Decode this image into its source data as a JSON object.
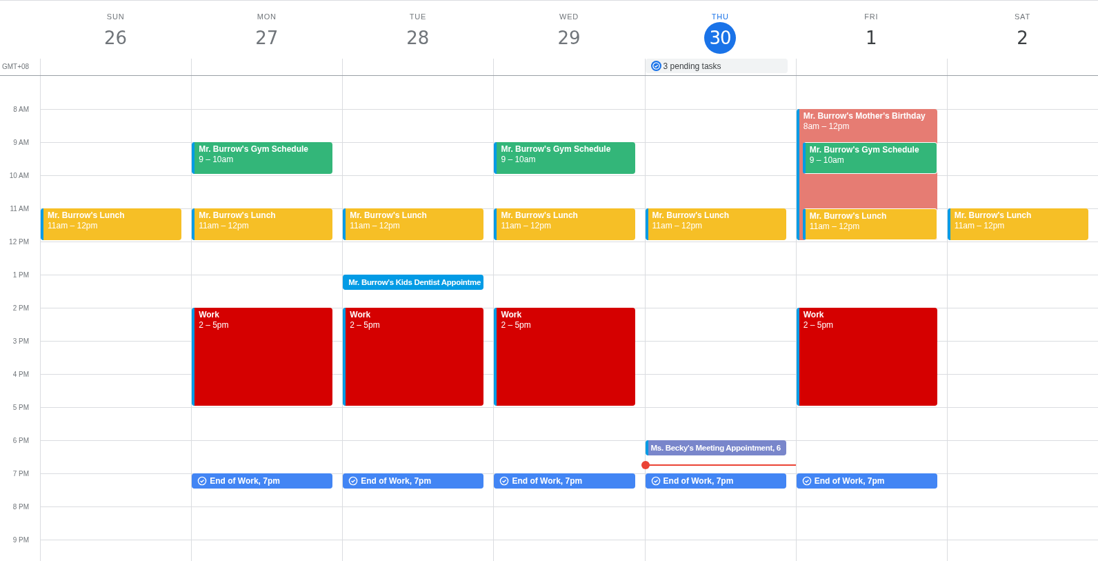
{
  "timezone": "GMT+08",
  "hours": [
    "8 AM",
    "9 AM",
    "10 AM",
    "11 AM",
    "12 PM",
    "1 PM",
    "2 PM",
    "3 PM",
    "4 PM",
    "5 PM",
    "6 PM",
    "7 PM",
    "8 PM",
    "9 PM"
  ],
  "days": [
    {
      "name": "SUN",
      "number": "26",
      "selected": false,
      "past": true,
      "slots": [
        [
          {
            "kind": "free"
          }
        ],
        [
          {
            "kind": "free"
          }
        ],
        [
          {
            "kind": "free"
          }
        ],
        [
          {
            "kind": "free"
          }
        ],
        [
          {
            "kind": "event",
            "title": "Mr. Burrow's Lunch",
            "time": "11am – 12pm",
            "color": "#f6bf26",
            "nested": false
          }
        ]
      ]
    },
    {
      "name": "MON",
      "number": "27",
      "selected": false,
      "past": true,
      "slots": [
        [
          {
            "kind": "free"
          }
        ],
        [
          {
            "kind": "free"
          }
        ],
        [
          {
            "kind": "event",
            "title": "Mr. Burrow's Gym Schedule",
            "time": "9 – 10am",
            "color": "#33b679",
            "nested": false
          }
        ],
        [
          {
            "kind": "free"
          }
        ],
        [
          {
            "kind": "event",
            "title": "Mr. Burrow's Lunch",
            "time": "11am – 12pm",
            "color": "#f6bf26",
            "nested": false
          }
        ],
        [
          {
            "kind": "free"
          }
        ],
        [
          {
            "kind": "free"
          }
        ],
        [
          {
            "kind": "event",
            "title": "Work",
            "time": "2 – 5pm",
            "color": "#d50000",
            "nested": false
          }
        ],
        [
          {
            "kind": "free"
          }
        ],
        [
          {
            "kind": "free"
          }
        ],
        [
          {
            "kind": "free"
          }
        ],
        [
          {
            "kind": "free"
          }
        ],
        [
          {
            "kind": "task",
            "title": "End of Work, 7pm",
            "color": "#4285f4",
            "nested": false
          }
        ]
      ]
    },
    {
      "name": "TUE",
      "number": "28",
      "selected": false,
      "past": true,
      "slots": [
        [
          {
            "kind": "free"
          }
        ],
        [
          {
            "kind": "free"
          }
        ],
        [
          {
            "kind": "free"
          }
        ],
        [
          {
            "kind": "free"
          }
        ],
        [
          {
            "kind": "event",
            "title": "Mr. Burrow's Lunch",
            "time": "11am – 12pm",
            "color": "#f6bf26",
            "nested": false
          }
        ],
        [
          {
            "kind": "free"
          }
        ],
        [
          {
            "kind": "compact",
            "title": "Mr. Burrow's Kids Dentist Appointme",
            "color": "#039be5",
            "nested": false
          }
        ],
        [
          {
            "kind": "event",
            "title": "Work",
            "time": "2 – 5pm",
            "color": "#d50000",
            "nested": false
          }
        ],
        [
          {
            "kind": "free"
          }
        ],
        [
          {
            "kind": "free"
          }
        ],
        [
          {
            "kind": "free"
          }
        ],
        [
          {
            "kind": "free"
          }
        ],
        [
          {
            "kind": "task",
            "title": "End of Work, 7pm",
            "color": "#4285f4",
            "nested": false
          }
        ]
      ]
    },
    {
      "name": "WED",
      "number": "29",
      "selected": false,
      "past": true,
      "slots": [
        [
          {
            "kind": "free"
          }
        ],
        [
          {
            "kind": "free"
          }
        ],
        [
          {
            "kind": "event",
            "title": "Mr. Burrow's Gym Schedule",
            "time": "9 – 10am",
            "color": "#33b679",
            "nested": false
          }
        ],
        [
          {
            "kind": "free"
          }
        ],
        [
          {
            "kind": "event",
            "title": "Mr. Burrow's Lunch",
            "time": "11am – 12pm",
            "color": "#f6bf26",
            "nested": false
          }
        ],
        [
          {
            "kind": "free"
          }
        ],
        [
          {
            "kind": "free"
          }
        ],
        [
          {
            "kind": "event",
            "title": "Work",
            "time": "2 – 5pm",
            "color": "#d50000",
            "nested": false
          }
        ],
        [
          {
            "kind": "free"
          }
        ],
        [
          {
            "kind": "free"
          }
        ],
        [
          {
            "kind": "free"
          }
        ],
        [
          {
            "kind": "free"
          }
        ],
        [
          {
            "kind": "task",
            "title": "End of Work, 7pm",
            "color": "#4285f4",
            "nested": false
          }
        ]
      ]
    },
    {
      "name": "THU",
      "number": "30",
      "selected": true,
      "past": false,
      "all_day": [
        {
          "kind": "tasks",
          "label": "3 pending tasks"
        }
      ],
      "slots": [
        [
          {
            "kind": "free"
          }
        ],
        [
          {
            "kind": "free"
          }
        ],
        [
          {
            "kind": "free"
          }
        ],
        [
          {
            "kind": "free"
          }
        ],
        [
          {
            "kind": "event",
            "title": "Mr. Burrow's Lunch",
            "time": "11am – 12pm",
            "color": "#f6bf26",
            "nested": false
          }
        ],
        [
          {
            "kind": "free"
          }
        ],
        [
          {
            "kind": "free"
          }
        ],
        [
          {
            "kind": "free"
          }
        ],
        [
          {
            "kind": "free"
          }
        ],
        [
          {
            "kind": "free"
          }
        ],
        [
          {
            "kind": "free"
          }
        ],
        [
          {
            "kind": "compact",
            "title": "Ms. Becky's Meeting Appointment, 6",
            "color": "#7986cb",
            "nested": false
          },
          {
            "kind": "now"
          }
        ],
        [
          {
            "kind": "task",
            "title": "End of Work, 7pm",
            "color": "#4285f4",
            "nested": false
          }
        ]
      ]
    },
    {
      "name": "FRI",
      "number": "1",
      "selected": false,
      "past": false,
      "slots": [
        [
          {
            "kind": "free"
          }
        ],
        [
          {
            "kind": "event",
            "title": "Mr. Burrow's Mother's Birthday",
            "time": "8am – 12pm",
            "color": "#e67c73",
            "nested": false
          }
        ],
        [
          {
            "kind": "event",
            "title": "Mr. Burrow's Gym Schedule",
            "time": "9 – 10am",
            "color": "#33b679",
            "nested": true
          }
        ],
        [
          {
            "kind": "free"
          }
        ],
        [
          {
            "kind": "event",
            "title": "Mr. Burrow's Lunch",
            "time": "11am – 12pm",
            "color": "#f6bf26",
            "nested": true
          }
        ],
        [
          {
            "kind": "free"
          }
        ],
        [
          {
            "kind": "free"
          }
        ],
        [
          {
            "kind": "event",
            "title": "Work",
            "time": "2 – 5pm",
            "color": "#d50000",
            "nested": false
          }
        ],
        [
          {
            "kind": "free"
          }
        ],
        [
          {
            "kind": "free"
          }
        ],
        [
          {
            "kind": "free"
          }
        ],
        [
          {
            "kind": "free"
          }
        ],
        [
          {
            "kind": "task",
            "title": "End of Work, 7pm",
            "color": "#4285f4",
            "nested": false
          }
        ]
      ]
    },
    {
      "name": "SAT",
      "number": "2",
      "selected": false,
      "past": false,
      "slots": [
        [
          {
            "kind": "free"
          }
        ],
        [
          {
            "kind": "free"
          }
        ],
        [
          {
            "kind": "free"
          }
        ],
        [
          {
            "kind": "free"
          }
        ],
        [
          {
            "kind": "event",
            "title": "Mr. Burrow's Lunch",
            "time": "11am – 12pm",
            "color": "#f6bf26",
            "nested": false
          }
        ]
      ]
    }
  ]
}
